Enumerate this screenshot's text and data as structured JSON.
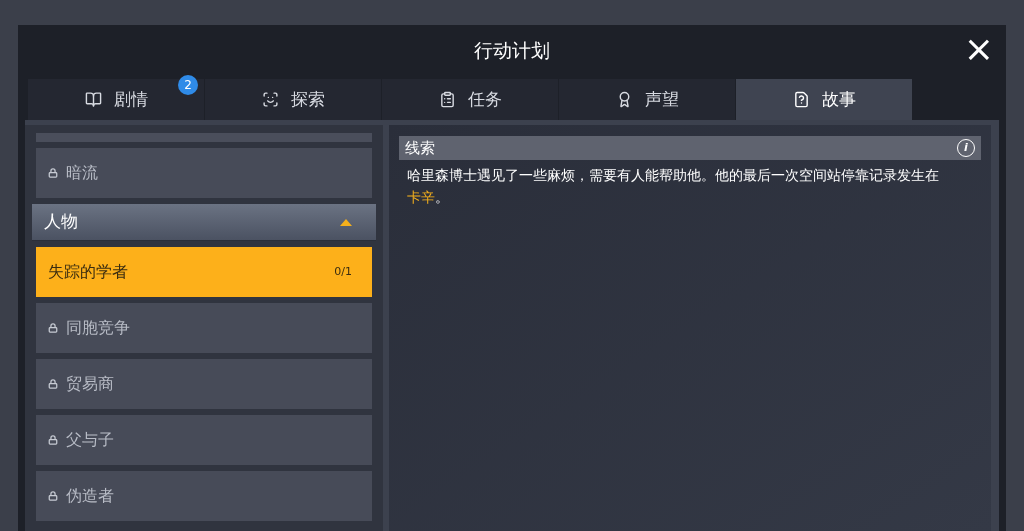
{
  "window": {
    "title": "行动计划",
    "close": "×"
  },
  "tabs": [
    {
      "label": "剧情",
      "badge": "2",
      "selected": false
    },
    {
      "label": "探索",
      "selected": false
    },
    {
      "label": "任务",
      "selected": false
    },
    {
      "label": "声望",
      "selected": false
    },
    {
      "label": "故事",
      "selected": true
    }
  ],
  "story_list": [
    {
      "kind": "locked",
      "label": "暗流"
    },
    {
      "kind": "header",
      "label": "人物",
      "expanded": true
    },
    {
      "kind": "quest",
      "label": "失踪的学者",
      "progress": "0/1",
      "selected": true
    },
    {
      "kind": "locked",
      "label": "同胞竞争"
    },
    {
      "kind": "locked",
      "label": "贸易商"
    },
    {
      "kind": "locked",
      "label": "父与子"
    },
    {
      "kind": "locked",
      "label": "伪造者"
    }
  ],
  "clue": {
    "title": "线索",
    "info": "i",
    "description": [
      {
        "text": "哈里森博士遇见了一些麻烦，需要有人能帮助他。他的最后一次空间站停靠记录发生在",
        "highlight": false
      },
      {
        "text": "卡辛",
        "highlight": true
      },
      {
        "text": "。",
        "highlight": false
      }
    ]
  }
}
